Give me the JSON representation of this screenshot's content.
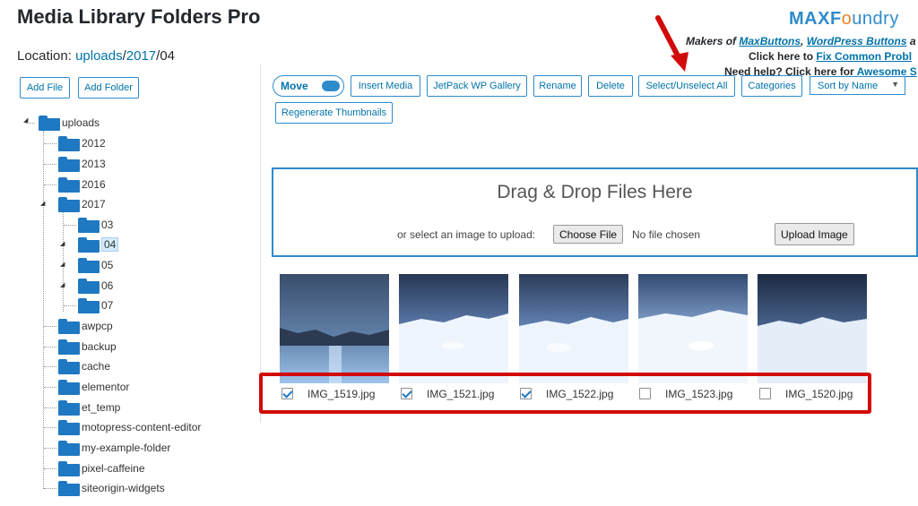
{
  "page": {
    "title": "Media Library Folders Pro"
  },
  "location": {
    "label": "Location:",
    "parts": [
      "uploads",
      "2017",
      "04"
    ],
    "sep": "/"
  },
  "actions": {
    "add_file": "Add File",
    "add_folder": "Add Folder"
  },
  "toolbar": {
    "move": "Move",
    "insert_media": "Insert Media",
    "jetpack_gallery": "JetPack WP Gallery",
    "rename": "Rename",
    "delete": "Delete",
    "select_unselect_all": "Select/Unselect All",
    "categories": "Categories",
    "sort_selected": "Sort by Name",
    "regenerate": "Regenerate Thumbnails"
  },
  "brand": {
    "logo_a": "MAX",
    "logo_b": "F",
    "logo_o": "o",
    "logo_c": "undry",
    "makers_prefix": "Makers of ",
    "makers_link1": "MaxButtons",
    "makers_sep": ", ",
    "makers_link2": "WordPress Buttons",
    "makers_tail": " a",
    "help1_prefix": "Click here to ",
    "help1_link": "Fix Common Probl",
    "help2_prefix": "Need help? Click here for ",
    "help2_link": "Awesome S"
  },
  "tree": {
    "root": "uploads",
    "items": [
      {
        "label": "2012"
      },
      {
        "label": "2013"
      },
      {
        "label": "2016"
      },
      {
        "label": "2017"
      },
      {
        "label": "03"
      },
      {
        "label": "04"
      },
      {
        "label": "05"
      },
      {
        "label": "06"
      },
      {
        "label": "07"
      },
      {
        "label": "awpcp"
      },
      {
        "label": "backup"
      },
      {
        "label": "cache"
      },
      {
        "label": "elementor"
      },
      {
        "label": "et_temp"
      },
      {
        "label": "motopress-content-editor"
      },
      {
        "label": "my-example-folder"
      },
      {
        "label": "pixel-caffeine"
      },
      {
        "label": "siteorigin-widgets"
      }
    ]
  },
  "upload": {
    "title": "Drag & Drop Files Here",
    "hint": "or select an image to upload:",
    "choose": "Choose File",
    "no_file": "No file chosen",
    "upload_btn": "Upload Image"
  },
  "files": [
    {
      "name": "IMG_1519.jpg",
      "checked": true
    },
    {
      "name": "IMG_1521.jpg",
      "checked": true
    },
    {
      "name": "IMG_1522.jpg",
      "checked": true
    },
    {
      "name": "IMG_1523.jpg",
      "checked": false
    },
    {
      "name": "IMG_1520.jpg",
      "checked": false
    }
  ],
  "colors": {
    "accent": "#2e8bcc",
    "link": "#0073aa",
    "folder": "#1e78c2",
    "highlight": "#d20a0a",
    "brand_o": "#e7832a"
  },
  "annotations": {
    "arrow_icon": "red-arrow-icon",
    "highlight": "selection-highlight-box"
  }
}
